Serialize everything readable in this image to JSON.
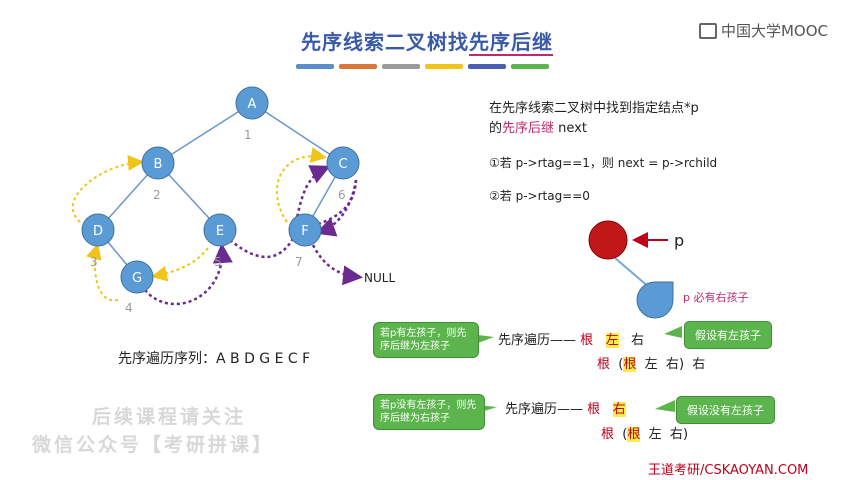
{
  "header": {
    "title_prefix": "先序线索二叉树找",
    "title_emph": "先序后继",
    "logo_text": "中国大学MOOC",
    "color_bars": [
      "#5b8fc9",
      "#d9773a",
      "#9b9b9b",
      "#f0c419",
      "#4b5fb5",
      "#5cb54c"
    ]
  },
  "tree": {
    "nodes": [
      "A",
      "B",
      "C",
      "D",
      "E",
      "F",
      "G"
    ],
    "order_numbers": [
      "1",
      "2",
      "6",
      "3",
      "5",
      "7",
      "4"
    ],
    "null_label": "NULL"
  },
  "traversal": {
    "label": "先序遍历序列：A B D G E C F"
  },
  "description": {
    "line1": "在先序线索二叉树中找到指定结点*p",
    "line2_prefix": "的",
    "line2_emph": "先序后继",
    "line2_suffix": " next",
    "rule1": "①若 p->rtag==1，则 next = p->rchild",
    "rule2": "②若 p->rtag==0"
  },
  "diagram": {
    "p_label": "p",
    "right_child_note": "p 必有右孩子"
  },
  "case_left": {
    "bubble": "若p有左孩子，则先序后继为左孩子",
    "order_prefix": "先序遍历——",
    "root1": "根",
    "left1": "左",
    "right1": "右",
    "assume_note": "假设有左孩子",
    "expand_root": "根",
    "expand_open": "(",
    "expand_inner_root": "根",
    "expand_left": "左",
    "expand_right": "右",
    "expand_close": ")",
    "expand_tail": "右"
  },
  "case_right": {
    "bubble": "若p没有左孩子，则先序后继为右孩子",
    "order_prefix": "先序遍历——",
    "root1": "根",
    "right1": "右",
    "assume_note": "假设没有左孩子",
    "expand_root": "根",
    "expand_open": "(",
    "expand_inner_root": "根",
    "expand_left": "左",
    "expand_right": "右",
    "expand_close": ")"
  },
  "watermark": {
    "line1": "后续课程请关注",
    "line2": "微信公众号【考研拼课】"
  },
  "footer": {
    "brand": "王道考研/CSKAOYAN.COM"
  }
}
